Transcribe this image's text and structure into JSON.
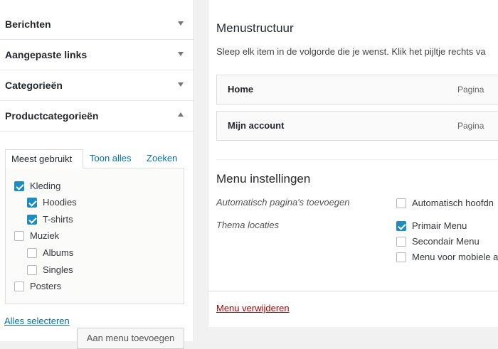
{
  "left": {
    "sections": [
      {
        "title": "Berichten",
        "expanded": false
      },
      {
        "title": "Aangepaste links",
        "expanded": false
      },
      {
        "title": "Categorieën",
        "expanded": false
      },
      {
        "title": "Productcategorieën",
        "expanded": true
      }
    ],
    "tabs": [
      "Meest gebruikt",
      "Toon alles",
      "Zoeken"
    ],
    "categories": [
      {
        "label": "Kleding",
        "checked": true,
        "level": 0
      },
      {
        "label": "Hoodies",
        "checked": true,
        "level": 1
      },
      {
        "label": "T-shirts",
        "checked": true,
        "level": 1
      },
      {
        "label": "Muziek",
        "checked": false,
        "level": 0
      },
      {
        "label": "Albums",
        "checked": false,
        "level": 1
      },
      {
        "label": "Singles",
        "checked": false,
        "level": 1
      },
      {
        "label": "Posters",
        "checked": false,
        "level": 0
      }
    ],
    "select_all": "Alles selecteren",
    "add_button": "Aan menu toevoegen"
  },
  "right": {
    "structure_title": "Menustructuur",
    "structure_desc": "Sleep elk item in de volgorde die je wenst. Klik het pijltje rechts va",
    "menu_items": [
      {
        "title": "Home",
        "type": "Pagina"
      },
      {
        "title": "Mijn account",
        "type": "Pagina"
      }
    ],
    "settings_title": "Menu instellingen",
    "auto_add_label": "Automatisch pagina's toevoegen",
    "auto_add_option": {
      "label": "Automatisch hoofdn",
      "checked": false
    },
    "locations_label": "Thema locaties",
    "locations": [
      {
        "label": "Primair Menu",
        "checked": true
      },
      {
        "label": "Secondair Menu",
        "checked": false
      },
      {
        "label": "Menu voor mobiele a",
        "checked": false
      }
    ],
    "delete_link": "Menu verwijderen"
  },
  "colors": {
    "accent": "#0073aa",
    "checkbox_checked": "#1e8cbe",
    "delete": "#a00000"
  }
}
